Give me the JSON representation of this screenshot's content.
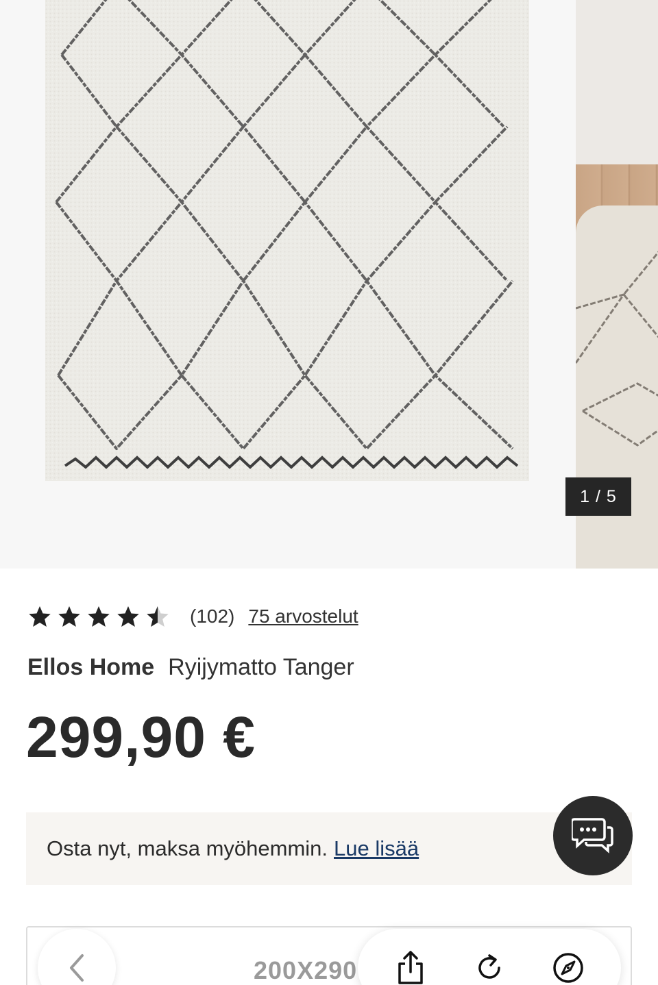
{
  "gallery": {
    "counter": "1 / 5",
    "current_image": 1,
    "total_images": 5
  },
  "rating": {
    "value": 4.5,
    "max": 5,
    "count": "(102)",
    "reviews_link": "75 arvostelut"
  },
  "product": {
    "brand": "Ellos Home",
    "name": "Ryijymatto Tanger",
    "price": "299,90 €"
  },
  "paylater": {
    "text": "Osta nyt, maksa myöhemmin.",
    "link": "Lue lisää"
  },
  "size_selector": {
    "value": "200X290"
  },
  "icons": {
    "chat": "chat-bubbles-icon",
    "prev": "chevron-left-icon",
    "share": "share-icon",
    "reload": "reload-icon",
    "compass": "compass-icon"
  },
  "colors": {
    "dark": "#262626",
    "link": "#1a3a66",
    "banner_bg": "#f7f5f2"
  }
}
